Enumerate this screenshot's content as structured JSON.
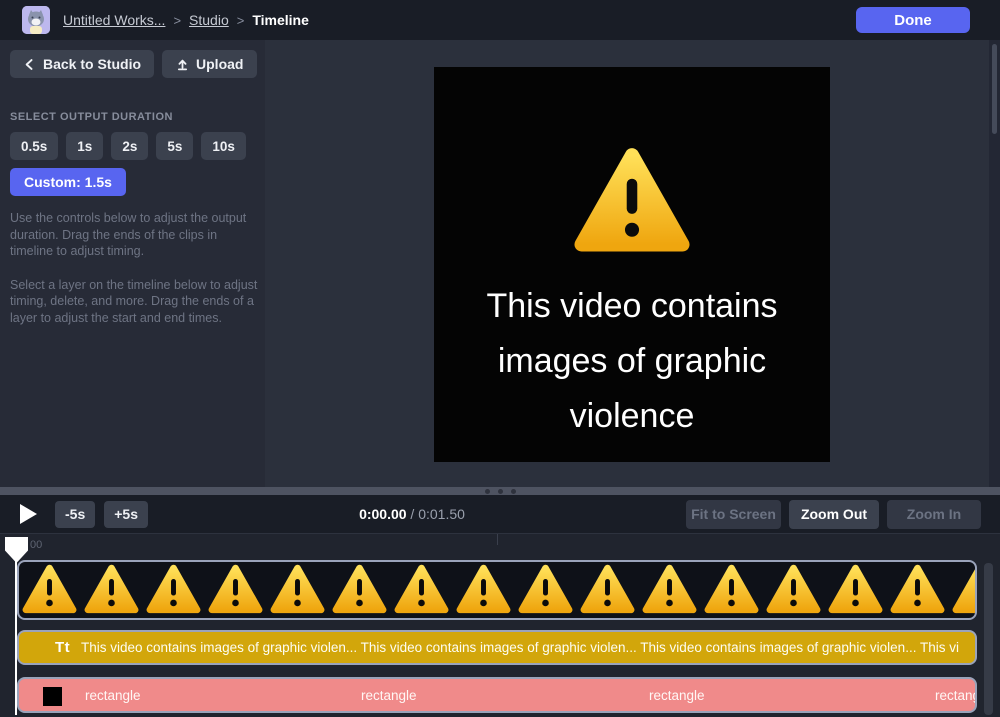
{
  "topbar": {
    "breadcrumb": {
      "workspace": "Untitled Works...",
      "separator": ">",
      "studio": "Studio",
      "current": "Timeline"
    },
    "done_label": "Done"
  },
  "sidebar": {
    "back_label": "Back to Studio",
    "upload_label": "Upload",
    "duration": {
      "heading": "SELECT OUTPUT DURATION",
      "options": [
        "0.5s",
        "1s",
        "2s",
        "5s",
        "10s"
      ],
      "custom_label": "Custom: 1.5s"
    },
    "help": [
      "Use the controls below to adjust the output duration. Drag the ends of the clips in timeline to adjust timing.",
      "Select a layer on the timeline below to adjust timing, delete, and more. Drag the ends of a layer to adjust the start and end times."
    ]
  },
  "canvas": {
    "warning_lines": [
      "This video contains",
      "images of graphic",
      "violence"
    ]
  },
  "playback": {
    "rewind": "-5s",
    "forward": "+5s",
    "current_time": "0:00.00",
    "duration": " / 0:01.50",
    "fit": "Fit to Screen",
    "zoom_out": "Zoom Out",
    "zoom_in": "Zoom In"
  },
  "timeline": {
    "ruler_start": "00",
    "image_track": {
      "thumbnail_count": 16
    },
    "text_track": {
      "icon_glyph": "Tt",
      "content": "This video contains images of graphic violen... This video contains images of graphic violen... This video contains images of graphic violen... This vi"
    },
    "rectangle_track": {
      "labels": [
        "rectangle",
        "rectangle",
        "rectangle",
        "rectangle"
      ]
    }
  },
  "colors": {
    "accent": "#5865F0",
    "warning_yellow_top": "#FFE058",
    "warning_yellow_bottom": "#EFA60F",
    "text_track_bg": "#D2A60B",
    "rectangle_track_bg": "#F08A8A",
    "track_border": "#9AA3BA"
  }
}
